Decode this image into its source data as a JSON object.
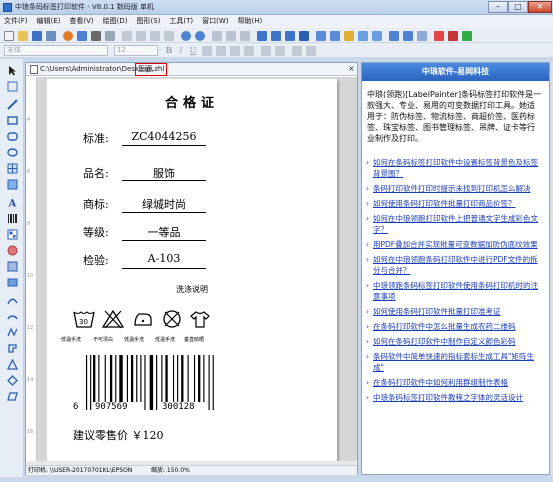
{
  "window": {
    "title": "中琅条码标签打印软件 - V8.0.1 数码版 单机",
    "minimize": "–",
    "maximize": "□",
    "close": "✕"
  },
  "menu": [
    "文件(F)",
    "编辑(E)",
    "查看(V)",
    "绘图(D)",
    "图形(S)",
    "工具(T)",
    "窗口(W)",
    "帮助(H)"
  ],
  "format_toolbar": {
    "font_placeholder": "宋体",
    "size_placeholder": "12",
    "bold": "B",
    "italic": "I",
    "underline": "U"
  },
  "document": {
    "path": "C:\\Users\\Administrator\\Desktop\\",
    "filename": "正面.zhl",
    "tab_close": "×"
  },
  "ruler_marks": [
    "4",
    "6",
    "8",
    "10",
    "12",
    "14",
    "16"
  ],
  "label": {
    "title": "合格证",
    "fields": [
      {
        "key": "标准:",
        "value": "ZC4044256"
      },
      {
        "key": "品名:",
        "value": "服饰"
      },
      {
        "key": "商标:",
        "value": "绿城时尚"
      },
      {
        "key": "等级:",
        "value": "一等品"
      },
      {
        "key": "检验:",
        "value": "A-103"
      }
    ],
    "wash_title": "洗涤说明",
    "care_icons": [
      "wash-30-icon",
      "no-bleach-icon",
      "low-iron-icon",
      "no-dryclean-icon",
      "hang-dry-icon"
    ],
    "care_captions": [
      "低温手洗",
      "不可漂白",
      "低温手洗",
      "低温手洗",
      "垂直晾晒"
    ],
    "barcode": {
      "d1": "6",
      "d2": "907569",
      "d3": "300128"
    },
    "price": "建议零售价 ￥120"
  },
  "status": {
    "printer": "打印机: \\\\USER-20170701KL\\EPSON",
    "zoom": "缩放: 150.0%"
  },
  "right_panel": {
    "title": "中琅软件-易网科技",
    "intro": "中琅(领跑)[LabelPainter]条码标签打印软件是一款强大、专业、易用的可变数据打印工具。她适用于：防伪标签、物流标签、商超价签、医药标签、珠宝标签、图书管理标签、吊牌、证卡等行业制作及打印。",
    "links": [
      "如何在条码标签打印软件中设置标签背景色及标签背景图？",
      "条码打印软件打印时提示未找到打印机怎么解决",
      "如何使用条码打印软件批量打印商品价签？",
      "如何在中琅领跑打印软件上把普通文字生成彩色文字？",
      "用PDF叠加合并实现批量可变数据加防伪底纹效果",
      "如何在中琅领跑条码打印软件中进行PDF文件的拆分与合并？",
      "中琅领跑条码标签打印软件使用条码打印机时的注意事项",
      "如何使用条码打印软件批量打印准考证",
      "在条码打印软件中怎么批量生成农药二维码",
      "如何在条码打印软件中制作自定义颜色彩码",
      "条码软件中简单快速的指标套标生成工具\"矩阵生成\"",
      "在条码打印软件中如何利用群组制作表格",
      "中琅条码标签打印软件教程之字体的灵活设计"
    ]
  },
  "colors": {
    "accent": "#2b63bf",
    "link": "#1a3db8",
    "highlight_border": "#e00000"
  }
}
